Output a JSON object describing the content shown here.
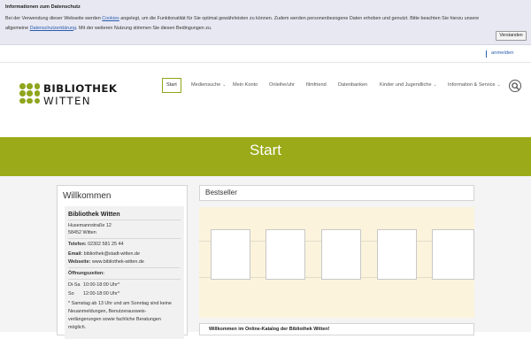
{
  "cookie": {
    "title": "Informationen zum Datenschutz",
    "text_1": "Bei der Verwendung dieser Webseite werden ",
    "link_cookies": "Cookies",
    "text_2": " angelegt, um die Funktionalität für Sie optimal gewährleisten zu können. Zudem werden personenbezogene Daten erhoben und genutzt. Bitte beachten Sie hierzu unsere allgemeine ",
    "link_privacy": "Datenschutzerklärung",
    "text_3": ". Mit der weiteren Nutzung stimmen Sie diesen Bedingungen zu.",
    "accept_label": "Verstanden"
  },
  "topbar": {
    "login_label": "anmelden"
  },
  "logo": {
    "line1": "BIBLIOTHEK",
    "line2": "WITTEN"
  },
  "nav": {
    "items": [
      {
        "label": "Start",
        "active": true
      },
      {
        "label": "Mediensuche",
        "dropdown": true
      },
      {
        "label": "Mein Konto"
      },
      {
        "label": "Onleihe/uhr"
      },
      {
        "label": "filmfriend"
      },
      {
        "label": "Datenbanken"
      },
      {
        "label": "Kinder und Jugendliche",
        "dropdown": true
      },
      {
        "label": "Information & Service",
        "dropdown": true
      }
    ],
    "search_icon": "search-icon"
  },
  "banner": {
    "title": "Start",
    "color": "#9aaa18"
  },
  "sidebar": {
    "title": "Willkommen",
    "name": "Bibliothek Witten",
    "street": "Husemannstraße 12",
    "city": "58452 Witten",
    "phone_label": "Telefon:",
    "phone": " 02302 581 25 44",
    "email_label": "Email:",
    "email": " bibliothek@stadt-witten.de",
    "web_label": "Webseite:",
    "web": " www.bibliothek-witten.de",
    "hours_label": "Öffnungszeiten:",
    "hours_1_day": "Di-Sa",
    "hours_1_time": "10:00-18:00 Uhr*",
    "hours_2_day": "So",
    "hours_2_time": "12:00-18:00 Uhr*",
    "note_1": "* Samstag ab 13 Uhr und am Sonntag sind keine",
    "note_2": "Neuanmeldungen, Benutzerausweis-",
    "note_3": "verlängerungen sowie fachliche Beratungen",
    "note_4": "möglich."
  },
  "main": {
    "bestseller_title": "Bestseller",
    "welcome_text": "Willkommen im Online-Katalog der Bibliothek Witten!"
  }
}
